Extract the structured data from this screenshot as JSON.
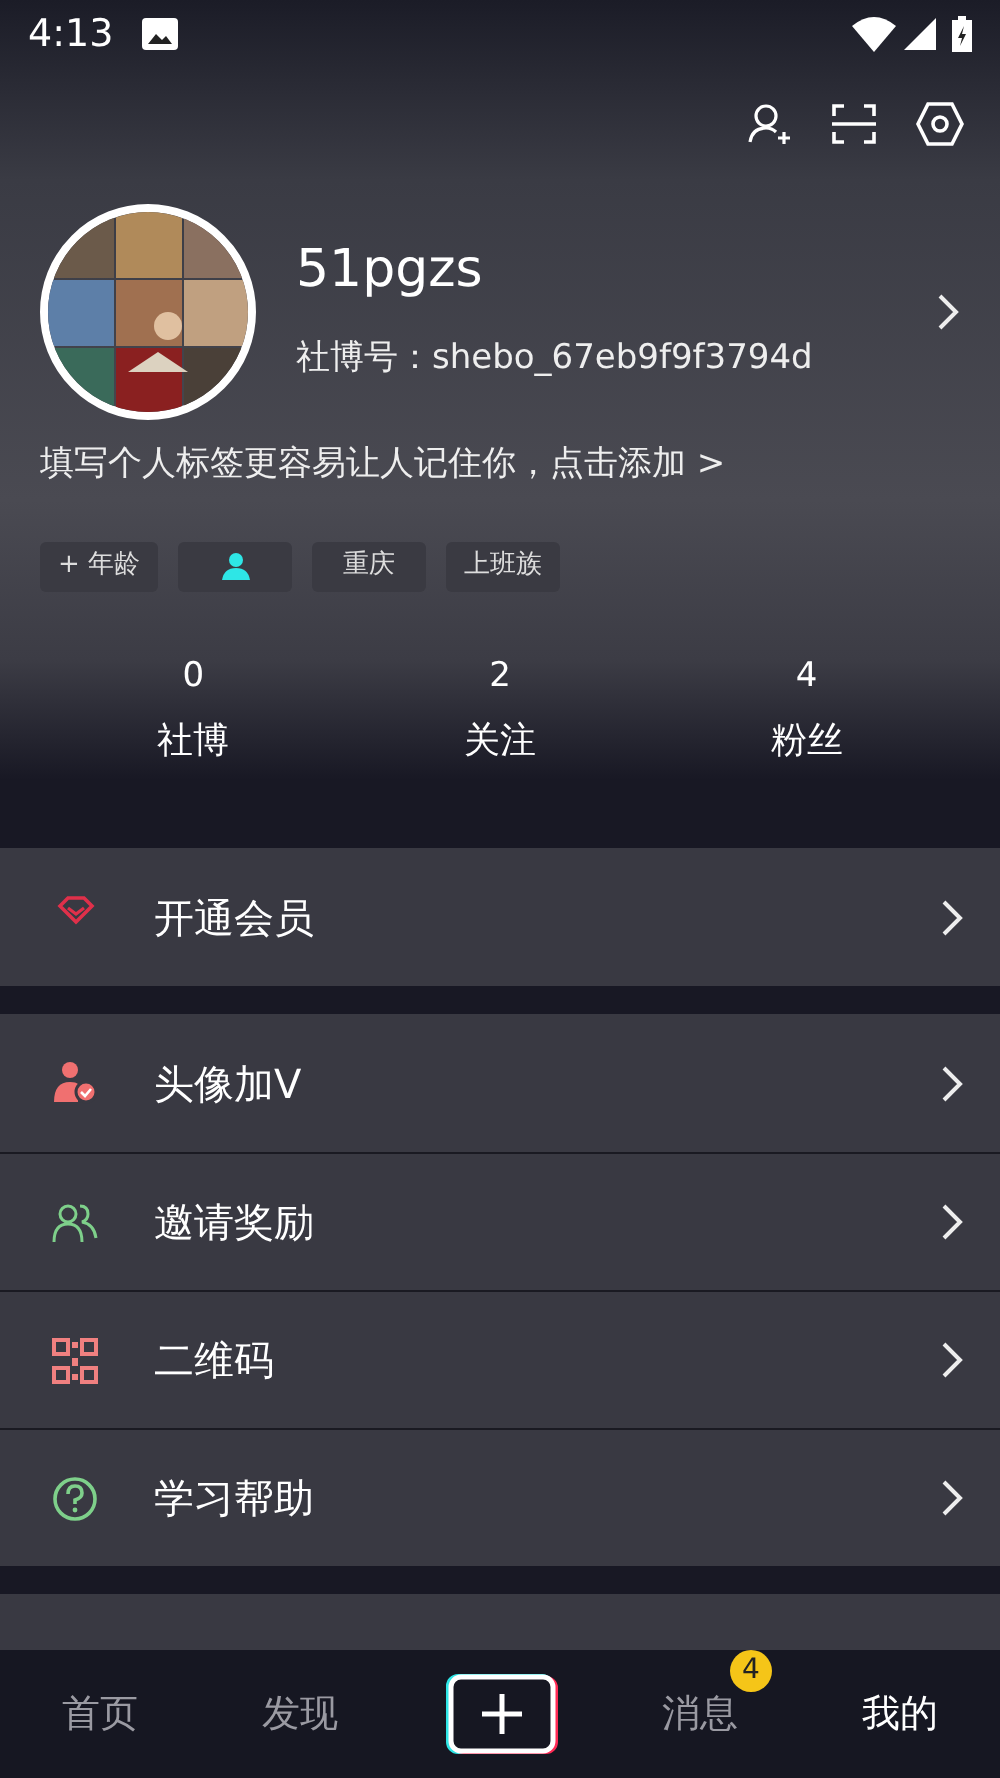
{
  "status_bar": {
    "time": "4:13"
  },
  "profile": {
    "name": "51pgzs",
    "id_line": "社博号：shebo_67eb9f9f3794d",
    "bio": "填写个人标签更容易让人记住你，点击添加 >",
    "tags": [
      {
        "kind": "text",
        "label": "+ 年龄"
      },
      {
        "kind": "person"
      },
      {
        "kind": "text",
        "label": "重庆"
      },
      {
        "kind": "text",
        "label": "上班族"
      }
    ]
  },
  "stats": [
    {
      "value": "0",
      "label": "社博"
    },
    {
      "value": "2",
      "label": "关注"
    },
    {
      "value": "4",
      "label": "粉丝"
    }
  ],
  "menu_groups": [
    [
      {
        "kind": "diamond",
        "label": "开通会员"
      }
    ],
    [
      {
        "kind": "verified",
        "label": "头像加V"
      },
      {
        "kind": "invite",
        "label": "邀请奖励"
      },
      {
        "kind": "qrcode",
        "label": "二维码"
      },
      {
        "kind": "help",
        "label": "学习帮助"
      }
    ]
  ],
  "bottom_nav": [
    {
      "kind": "text",
      "label": "首页",
      "selected": false
    },
    {
      "kind": "text",
      "label": "发现",
      "selected": false
    },
    {
      "kind": "plus"
    },
    {
      "kind": "text",
      "label": "消息",
      "selected": false,
      "badge": "4"
    },
    {
      "kind": "text",
      "label": "我的",
      "selected": true
    }
  ]
}
